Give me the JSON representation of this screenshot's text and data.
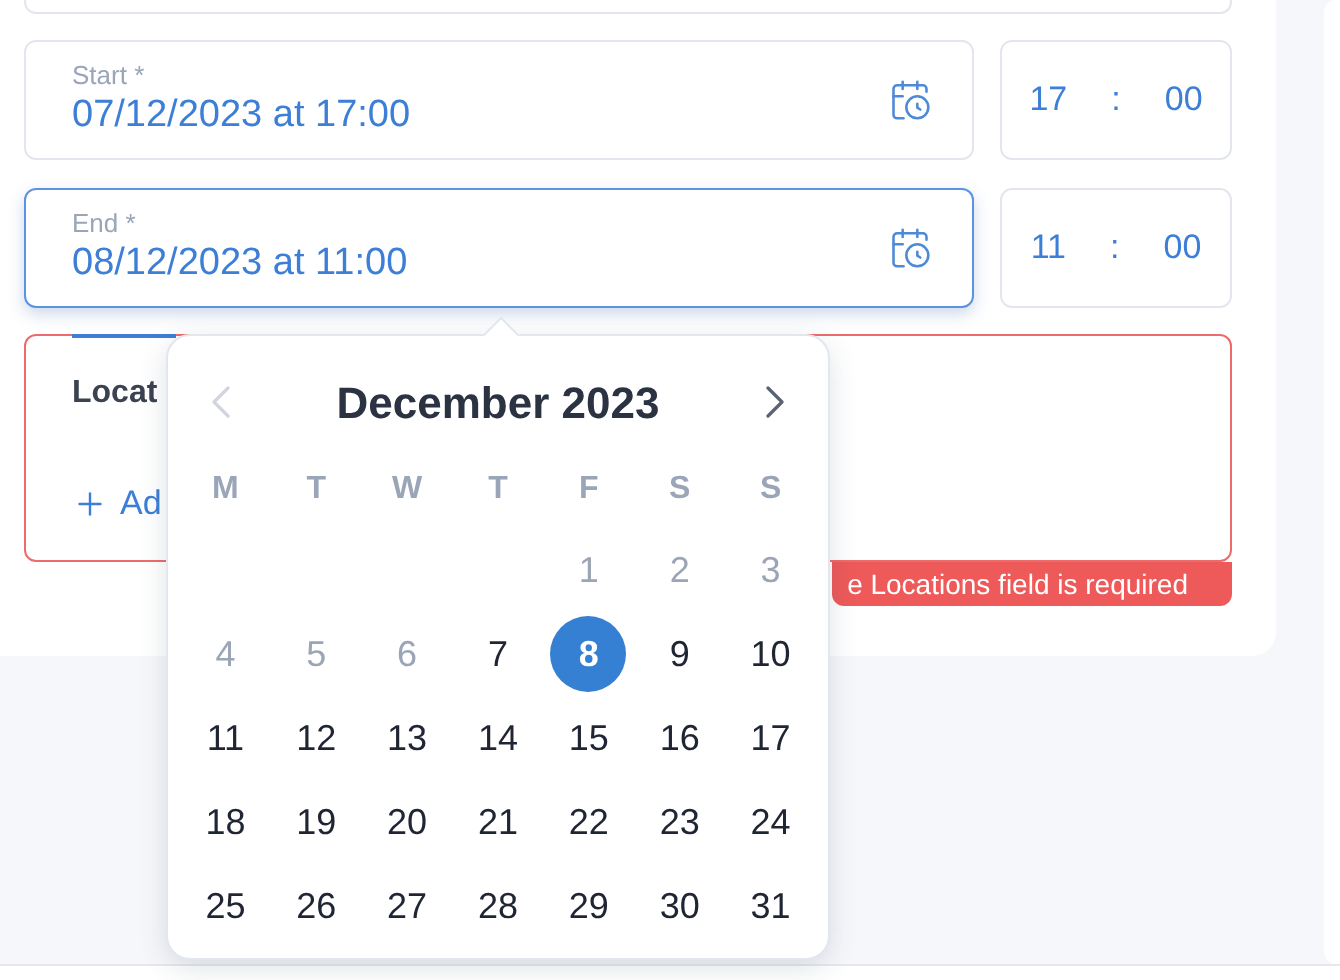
{
  "start": {
    "label": "Start *",
    "value": "07/12/2023 at 17:00",
    "focused": false,
    "hour": "17",
    "separator": ":",
    "minute": "00"
  },
  "end": {
    "label": "End *",
    "value": "08/12/2023 at 11:00",
    "focused": true,
    "hour": "11",
    "separator": ":",
    "minute": "00"
  },
  "locations": {
    "title": "Locat",
    "add_label": "Ad",
    "error": "e Locations field is required"
  },
  "calendar": {
    "month": "December 2023",
    "prev": {
      "disabled": true
    },
    "next": {
      "disabled": false
    },
    "weekdays": [
      "M",
      "T",
      "W",
      "T",
      "F",
      "S",
      "S"
    ],
    "weeks": [
      [
        {
          "day": "1",
          "disabled": true,
          "selected": false
        },
        {
          "day": "2",
          "disabled": true,
          "selected": false
        },
        {
          "day": "3",
          "disabled": true,
          "selected": false
        }
      ],
      [
        {
          "day": "4",
          "disabled": true,
          "selected": false
        },
        {
          "day": "5",
          "disabled": true,
          "selected": false
        },
        {
          "day": "6",
          "disabled": true,
          "selected": false
        },
        {
          "day": "7",
          "disabled": false,
          "selected": false
        },
        {
          "day": "8",
          "disabled": false,
          "selected": true
        },
        {
          "day": "9",
          "disabled": false,
          "selected": false
        },
        {
          "day": "10",
          "disabled": false,
          "selected": false
        }
      ],
      [
        {
          "day": "11",
          "disabled": false,
          "selected": false
        },
        {
          "day": "12",
          "disabled": false,
          "selected": false
        },
        {
          "day": "13",
          "disabled": false,
          "selected": false
        },
        {
          "day": "14",
          "disabled": false,
          "selected": false
        },
        {
          "day": "15",
          "disabled": false,
          "selected": false
        },
        {
          "day": "16",
          "disabled": false,
          "selected": false
        },
        {
          "day": "17",
          "disabled": false,
          "selected": false
        }
      ],
      [
        {
          "day": "18",
          "disabled": false,
          "selected": false
        },
        {
          "day": "19",
          "disabled": false,
          "selected": false
        },
        {
          "day": "20",
          "disabled": false,
          "selected": false
        },
        {
          "day": "21",
          "disabled": false,
          "selected": false
        },
        {
          "day": "22",
          "disabled": false,
          "selected": false
        },
        {
          "day": "23",
          "disabled": false,
          "selected": false
        },
        {
          "day": "24",
          "disabled": false,
          "selected": false
        }
      ],
      [
        {
          "day": "25",
          "disabled": false,
          "selected": false
        },
        {
          "day": "26",
          "disabled": false,
          "selected": false
        },
        {
          "day": "27",
          "disabled": false,
          "selected": false
        },
        {
          "day": "28",
          "disabled": false,
          "selected": false
        },
        {
          "day": "29",
          "disabled": false,
          "selected": false
        },
        {
          "day": "30",
          "disabled": false,
          "selected": false
        },
        {
          "day": "31",
          "disabled": false,
          "selected": false
        }
      ]
    ]
  }
}
